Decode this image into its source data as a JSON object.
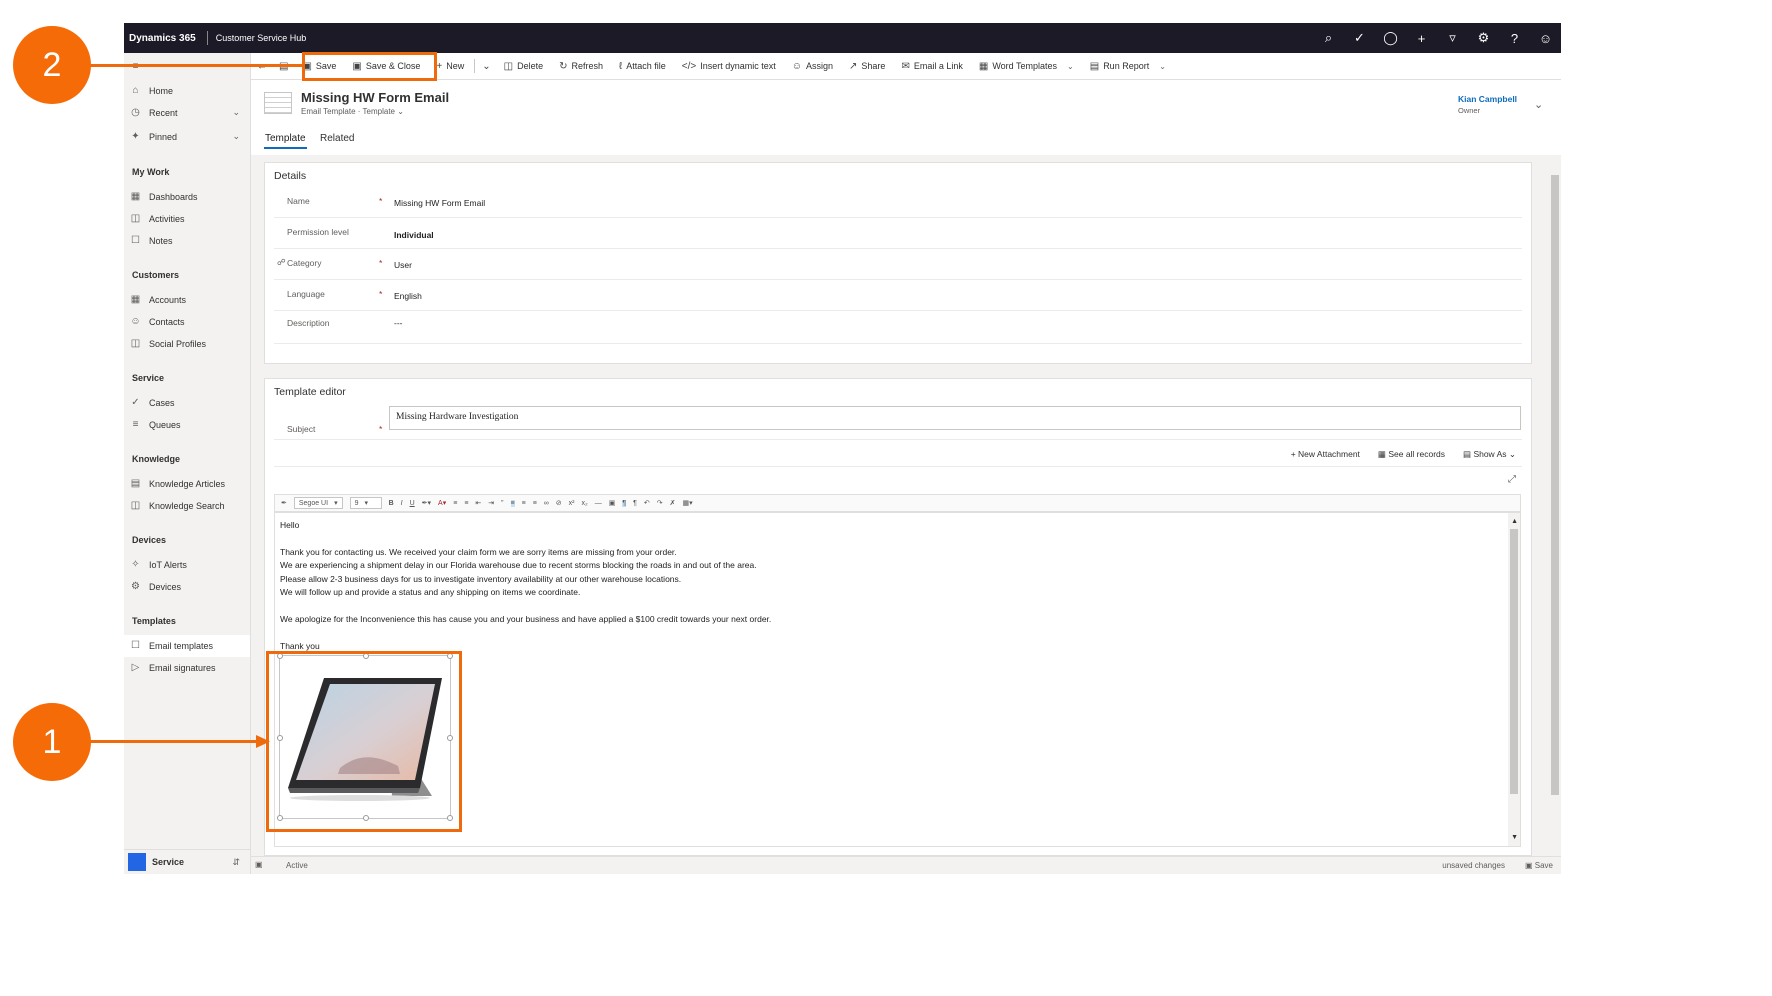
{
  "topnav": {
    "brand": "Dynamics 365",
    "app_name": "Customer Service Hub",
    "icons": [
      "search-icon",
      "task-icon",
      "lightbulb-icon",
      "plus-icon",
      "filter-icon",
      "gear-icon",
      "help-icon",
      "user-icon"
    ]
  },
  "commands": {
    "save": "Save",
    "save_close": "Save & Close",
    "new": "New",
    "delete": "Delete",
    "refresh": "Refresh",
    "attach": "Attach file",
    "insert_dynamic": "Insert dynamic text",
    "assign": "Assign",
    "share": "Share",
    "email_link": "Email a Link",
    "word_templates": "Word Templates",
    "run_report": "Run Report"
  },
  "sidebar": {
    "home": "Home",
    "recent": "Recent",
    "pinned": "Pinned",
    "my_work": {
      "title": "My Work",
      "items": [
        "Dashboards",
        "Activities",
        "Notes"
      ]
    },
    "customers": {
      "title": "Customers",
      "items": [
        "Accounts",
        "Contacts",
        "Social Profiles"
      ]
    },
    "service": {
      "title": "Service",
      "items": [
        "Cases",
        "Queues"
      ]
    },
    "knowledge": {
      "title": "Knowledge",
      "items": [
        "Knowledge Articles",
        "Knowledge Search"
      ]
    },
    "devices": {
      "title": "Devices",
      "items": [
        "IoT Alerts",
        "Devices"
      ]
    },
    "templates": {
      "title": "Templates",
      "items": [
        "Email templates",
        "Email signatures"
      ]
    },
    "area": "Service"
  },
  "record": {
    "title": "Missing HW Form Email",
    "entity": "Email Template",
    "form": "Template",
    "owner_name": "Kian Campbell",
    "owner_label": "Owner"
  },
  "tabs": {
    "template": "Template",
    "related": "Related"
  },
  "details": {
    "title": "Details",
    "name_label": "Name",
    "name_value": "Missing HW Form Email",
    "permission_label": "Permission level",
    "permission_value": "Individual",
    "category_label": "Category",
    "category_value": "User",
    "language_label": "Language",
    "language_value": "English",
    "description_label": "Description",
    "description_value": "---",
    "required_mark": "*"
  },
  "editor": {
    "title": "Template editor",
    "subject_label": "Subject",
    "subject_value": "Missing Hardware Investigation",
    "new_attachment": "New Attachment",
    "see_all": "See all records",
    "show_as": "Show As",
    "font": "Segoe UI",
    "size": "9",
    "body": {
      "greeting": "Hello",
      "line1": "Thank you for contacting us.  We received your claim form we are sorry items are missing from your order.",
      "line2": "We are experiencing a shipment delay in our Florida warehouse due to recent storms blocking the roads in and out of the area.",
      "line3": "Please allow 2-3 business days for us to investigate inventory availability at our other warehouse locations.",
      "line4": "We will follow up and provide a status and any shipping on items we coordinate.",
      "line5": "We apologize for the Inconvenience this has cause you and your business and have applied a $100 credit towards your next order.",
      "closing": "Thank you"
    }
  },
  "status": {
    "state": "Active",
    "unsaved": "unsaved changes",
    "save": "Save"
  },
  "callouts": {
    "one": "1",
    "two": "2"
  },
  "colors": {
    "accent": "#ee6a0c",
    "nav": "#1b1a26",
    "link": "#0f6cbd"
  }
}
